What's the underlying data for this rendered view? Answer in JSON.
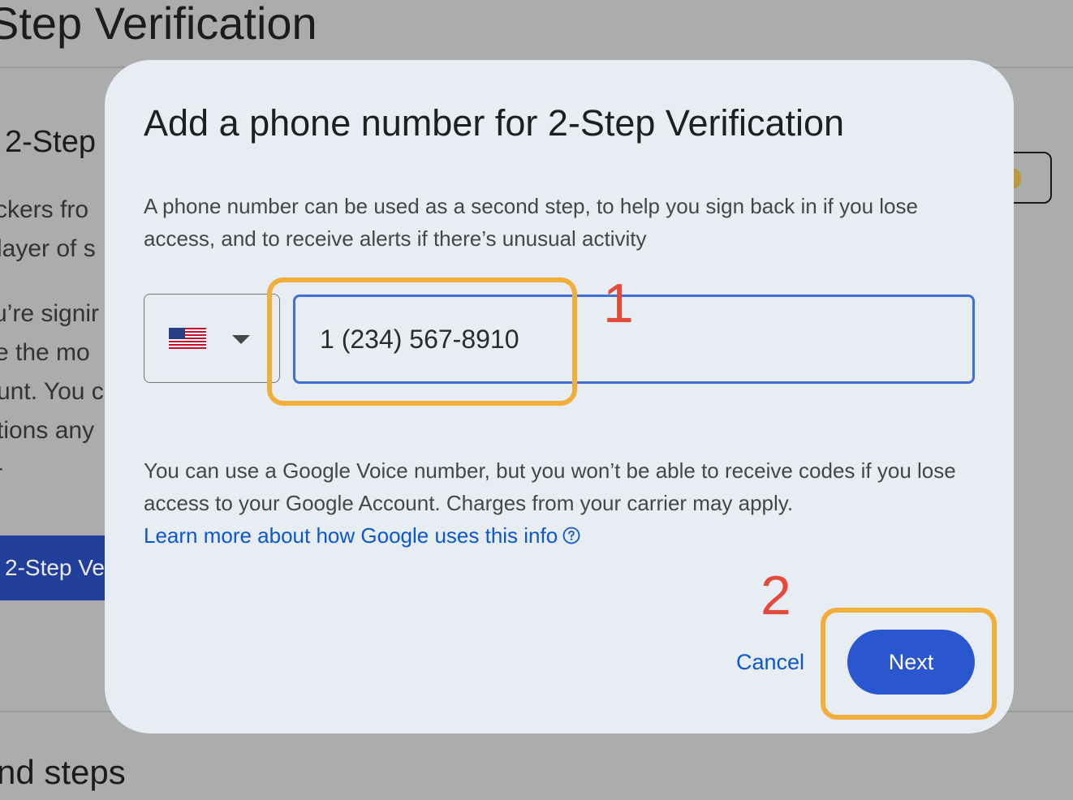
{
  "background": {
    "page_title": "Step Verification",
    "section_title": "2-Step",
    "text_fragments": [
      "ckers fro",
      "layer of s",
      "u’re signir",
      "e the mo",
      "unt. You c",
      "tions any",
      "-"
    ],
    "button_label": "2-Step Ve",
    "bottom_title": "nd steps",
    "toggle_color": "#b89a3a"
  },
  "dialog": {
    "title": "Add a phone number for 2-Step Verification",
    "description": "A phone number can be used as a second step, to help you sign back in if you lose access, and to receive alerts if there’s unusual activity",
    "country": {
      "flag_icon": "us-flag-icon",
      "dropdown_icon": "arrow-drop-down-icon"
    },
    "phone": {
      "value": "1 (234) 567-8910"
    },
    "note": "You can use a Google Voice number, but you won’t be able to receive codes if you lose access to your Google Account. Charges from your carrier may apply.",
    "learn_more": "Learn more about how Google uses this info",
    "help_icon": "help-circle-icon",
    "cancel_label": "Cancel",
    "next_label": "Next"
  },
  "annotations": {
    "marker_1": "1",
    "marker_2": "2",
    "highlight_color": "#f2ae3a",
    "marker_color": "#e34a3b"
  },
  "colors": {
    "overlay": "#acacac",
    "dialog_bg": "#e8edf3",
    "primary": "#2a56cf",
    "link": "#0b57d0",
    "input_border": "#3f6fd8"
  }
}
